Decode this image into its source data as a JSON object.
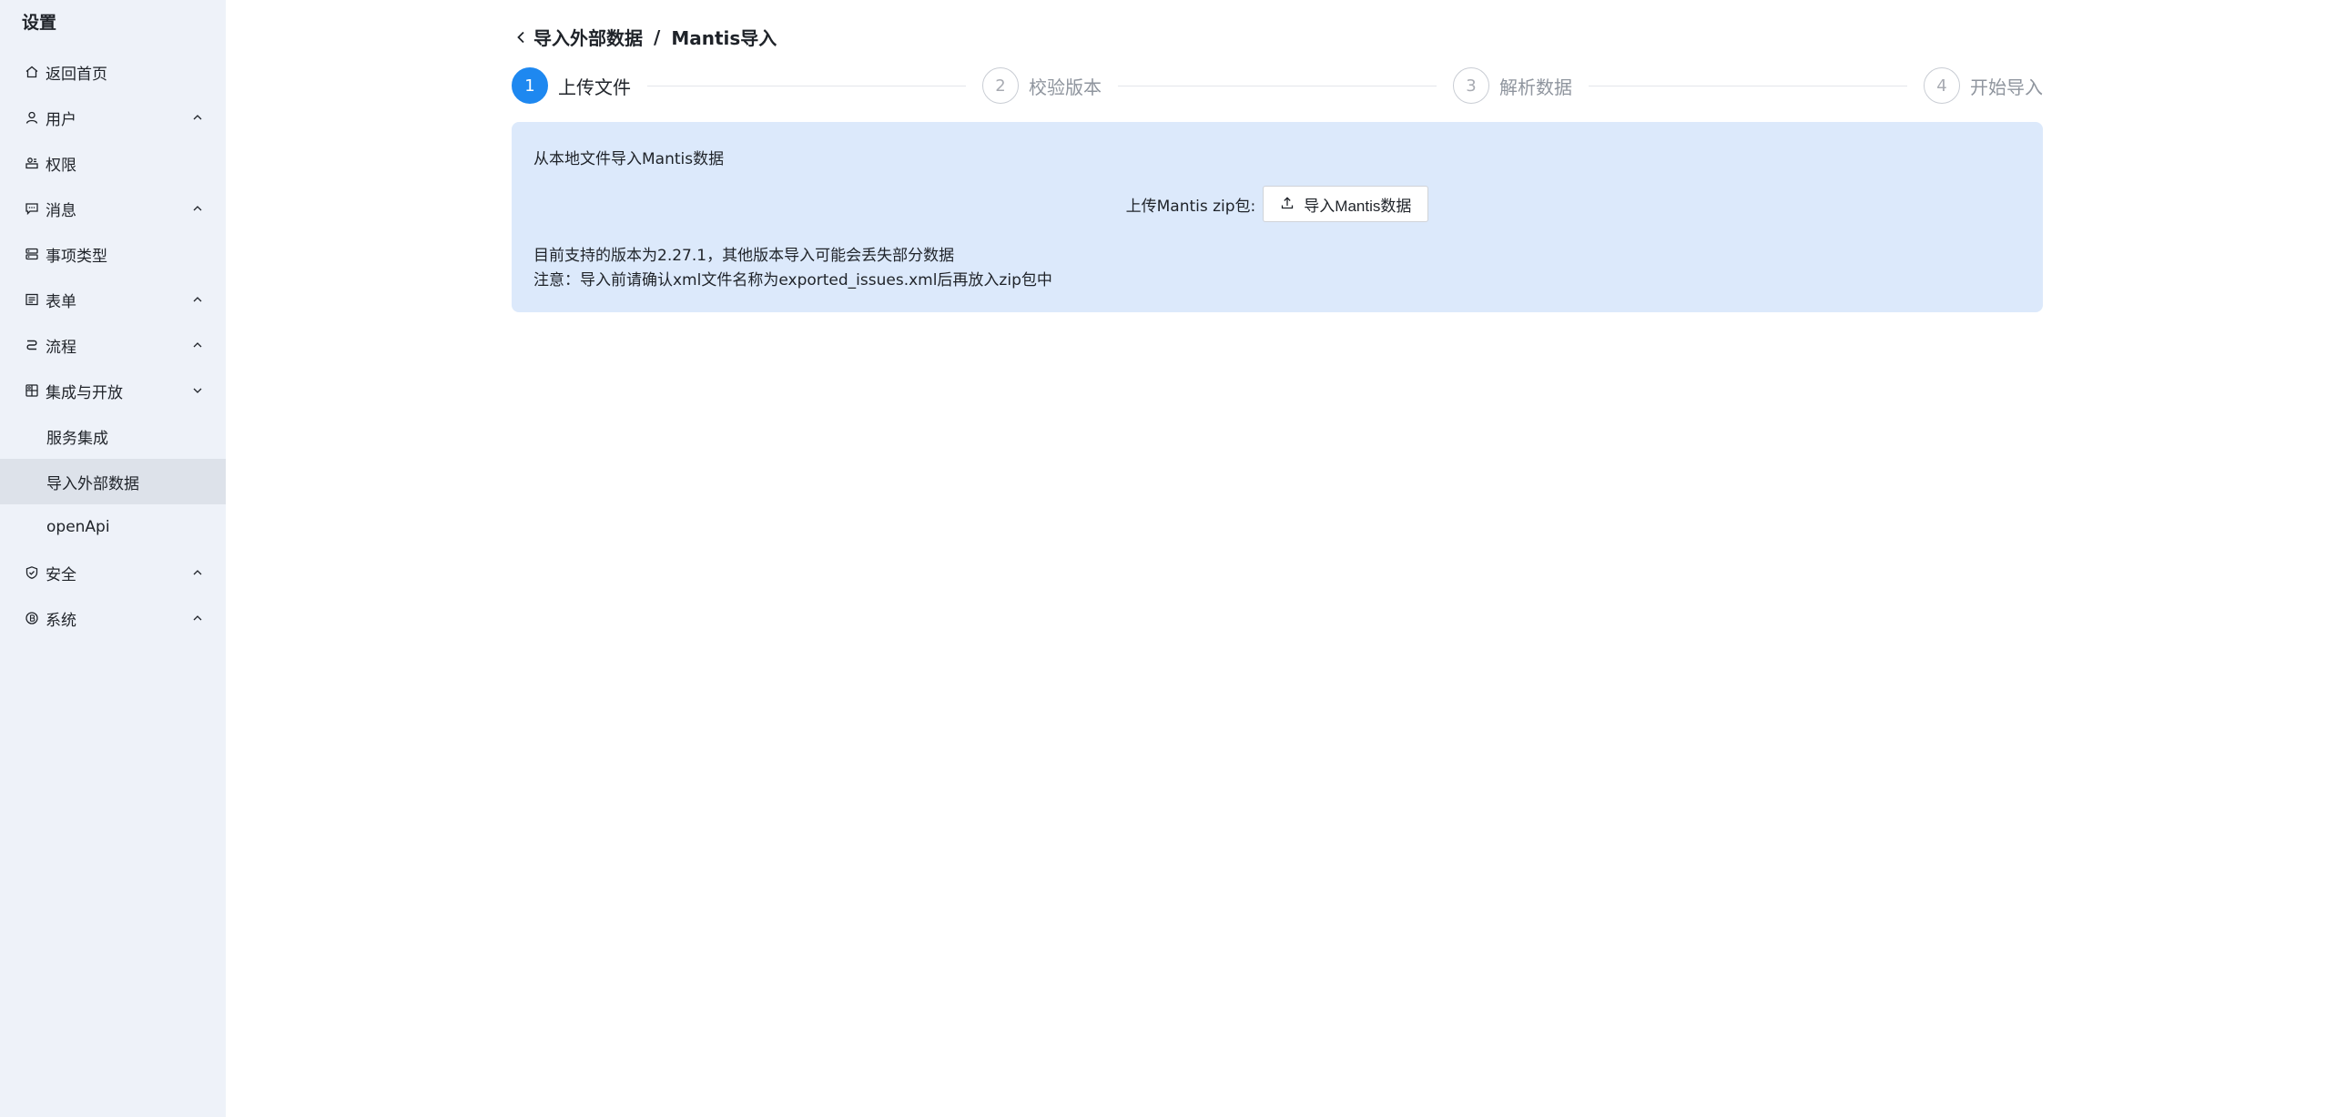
{
  "sidebar": {
    "title": "设置",
    "items": [
      {
        "label": "返回首页",
        "icon": "home-icon",
        "chevron": ""
      },
      {
        "label": "用户",
        "icon": "user-icon",
        "chevron": "up"
      },
      {
        "label": "权限",
        "icon": "permission-icon",
        "chevron": ""
      },
      {
        "label": "消息",
        "icon": "message-icon",
        "chevron": "up"
      },
      {
        "label": "事项类型",
        "icon": "item-type-icon",
        "chevron": ""
      },
      {
        "label": "表单",
        "icon": "form-icon",
        "chevron": "up"
      },
      {
        "label": "流程",
        "icon": "workflow-icon",
        "chevron": "up"
      },
      {
        "label": "集成与开放",
        "icon": "integration-icon",
        "chevron": "down"
      }
    ],
    "subitems": [
      {
        "label": "服务集成",
        "active": false
      },
      {
        "label": "导入外部数据",
        "active": true
      },
      {
        "label": "openApi",
        "active": false
      }
    ],
    "items_after": [
      {
        "label": "安全",
        "icon": "security-icon",
        "chevron": "up"
      },
      {
        "label": "系统",
        "icon": "system-icon",
        "chevron": "up"
      }
    ]
  },
  "breadcrumb": {
    "parent": "导入外部数据",
    "separator": "/",
    "current": "Mantis导入"
  },
  "steps": [
    {
      "num": "1",
      "label": "上传文件",
      "active": true
    },
    {
      "num": "2",
      "label": "校验版本",
      "active": false
    },
    {
      "num": "3",
      "label": "解析数据",
      "active": false
    },
    {
      "num": "4",
      "label": "开始导入",
      "active": false
    }
  ],
  "panel": {
    "title": "从本地文件导入Mantis数据",
    "upload_label": "上传Mantis zip包:",
    "upload_button": "导入Mantis数据",
    "note_version": "目前支持的版本为2.27.1，其他版本导入可能会丢失部分数据",
    "note_filename": "注意：导入前请确认xml文件名称为exported_issues.xml后再放入zip包中"
  },
  "colors": {
    "sidebar_bg": "#eef2f9",
    "active_sub_bg": "#dde2ea",
    "accent": "#1e88f0",
    "panel_bg": "#dce9fb"
  }
}
